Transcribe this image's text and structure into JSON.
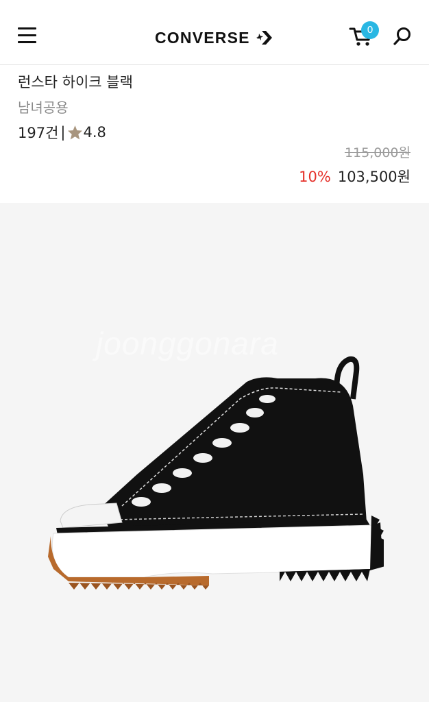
{
  "header": {
    "brand": "CONVERSE",
    "cart_count": "0",
    "icons": [
      "menu-icon",
      "cart-icon",
      "search-icon",
      "converse-star-chevron-icon"
    ],
    "accent_color": "#29b7e3"
  },
  "product": {
    "name": "런스타 하이크 블랙",
    "gender": "남녀공용",
    "review_count": "197건",
    "separator": "|",
    "rating": "4.8",
    "original_price": "115,000원",
    "discount": "10%",
    "sale_price": "103,500원",
    "discount_color": "#e5312a",
    "star_color": "#a8957e"
  },
  "image": {
    "watermark": "joonggonara"
  }
}
